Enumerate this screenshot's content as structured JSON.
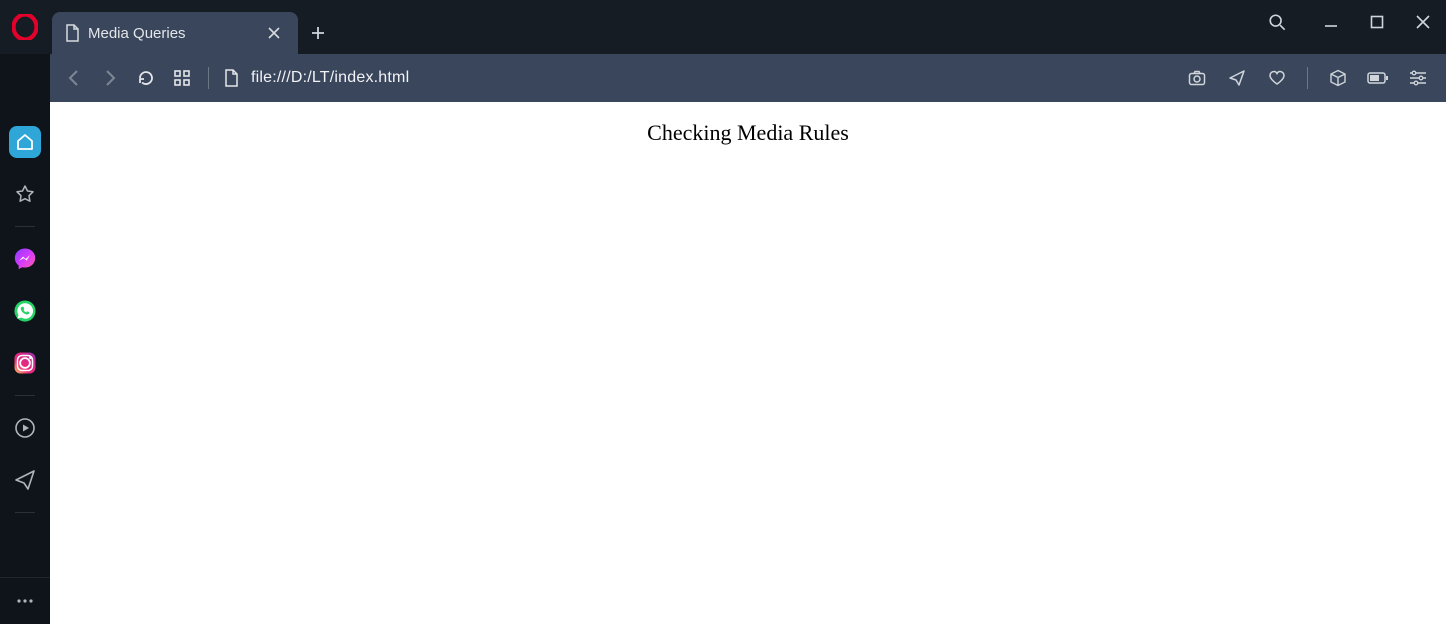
{
  "tab": {
    "title": "Media Queries"
  },
  "address": {
    "url": "file:///D:/LT/index.html"
  },
  "page": {
    "heading": "Checking Media Rules"
  },
  "icons": {
    "opera": "opera-logo",
    "file": "file-icon",
    "close": "close-icon",
    "plus": "plus-icon",
    "search": "search-icon",
    "minimize": "minimize-icon",
    "maximize": "maximize-icon",
    "window_close": "window-close-icon",
    "back": "back-icon",
    "forward": "forward-icon",
    "reload": "reload-icon",
    "speed_dial": "speed-dial-icon",
    "snapshot": "snapshot-icon",
    "send": "send-icon",
    "heart": "heart-icon",
    "cube": "cube-icon",
    "battery": "battery-icon",
    "easy_setup": "easy-setup-icon",
    "home": "home-icon",
    "star": "star-icon",
    "messenger": "messenger-icon",
    "whatsapp": "whatsapp-icon",
    "instagram": "instagram-icon",
    "play": "play-icon",
    "plane": "plane-icon",
    "more": "more-icon"
  }
}
